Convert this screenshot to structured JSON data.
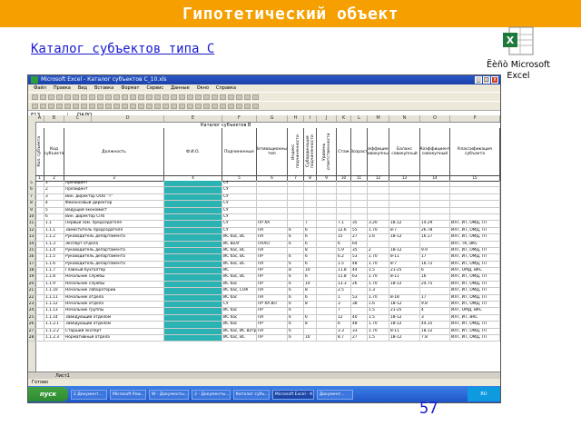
{
  "slide": {
    "title": "Гипотетический объект",
    "subtitle": "Каталог субъектов типа С",
    "page_number": "57",
    "object_label_line1": "Ëèñò Microsoft",
    "object_label_line2": "Excel",
    "colors": {
      "header_bar": "#f5a000",
      "title_text": "#ffffff",
      "subtitle_text": "#1a1ad0"
    }
  },
  "excel": {
    "window_title": "Microsoft Excel - Каталог субъектов С_10.xls",
    "menu": [
      "Файл",
      "Правка",
      "Вид",
      "Вставка",
      "Формат",
      "Сервис",
      "Данные",
      "Окно",
      "Справка"
    ],
    "name_box": "F13",
    "formula": "ПАЛО",
    "columns": [
      "A",
      "B",
      "C",
      "D",
      "E",
      "F",
      "G",
      "H",
      "I",
      "J",
      "K",
      "L",
      "M",
      "N",
      "O",
      "P"
    ],
    "sheet_title": "Каталог субъектов В",
    "table_headers": [
      "Кол. субъекта",
      "Код субъекта",
      "Должность",
      "Ф.И.О.",
      "Подчиненные",
      "Мотивационный тип",
      "Индекс подчиненности",
      "Субординация подчиненности",
      "Уровень ответственности",
      "Стаж",
      "Возраст",
      "Коэффициент совокупный",
      "Баланс совокупный",
      "Коэффициент совокупный",
      "Классификация субъекта"
    ],
    "rows": [
      {
        "n": "5",
        "code": "1",
        "pos": "Президент",
        "sub": "СУ",
        "mt": "",
        "v1": "",
        "v2": "",
        "v3": "",
        "st": "",
        "age": "",
        "k1": "",
        "b": "",
        "k2": "",
        "cls": ""
      },
      {
        "n": "6",
        "code": "2",
        "pos": "Президент",
        "sub": "СУ",
        "mt": "",
        "v1": "",
        "v2": "",
        "v3": "",
        "st": "",
        "age": "",
        "k1": "",
        "b": "",
        "k2": "",
        "cls": ""
      },
      {
        "n": "7",
        "code": "3",
        "pos": "Вин. директор ООО \"Т\"",
        "sub": "СУ",
        "mt": "",
        "v1": "",
        "v2": "",
        "v3": "",
        "st": "",
        "age": "",
        "k1": "",
        "b": "",
        "k2": "",
        "cls": ""
      },
      {
        "n": "8",
        "code": "4",
        "pos": "Финансовый директор",
        "sub": "СУ",
        "mt": "",
        "v1": "",
        "v2": "",
        "v3": "",
        "st": "",
        "age": "",
        "k1": "",
        "b": "",
        "k2": "",
        "cls": ""
      },
      {
        "n": "9",
        "code": "5",
        "pos": "Ведущий экономист",
        "sub": "СУ",
        "mt": "",
        "v1": "",
        "v2": "",
        "v3": "",
        "st": "",
        "age": "",
        "k1": "",
        "b": "",
        "k2": "",
        "cls": ""
      },
      {
        "n": "10",
        "code": "6",
        "pos": "Вин. директор СПб",
        "sub": "СУ",
        "mt": "",
        "v1": "",
        "v2": "",
        "v3": "",
        "st": "",
        "age": "",
        "k1": "",
        "b": "",
        "k2": "",
        "cls": ""
      },
      {
        "n": "11",
        "code": "1.1",
        "pos": "Первый зам. председателя",
        "sub": "СУ",
        "mt": "ПР ХА",
        "v1": "",
        "v2": "7",
        "v3": "",
        "st": "7.1",
        "age": "35",
        "k1": "3.20",
        "b": "18.12",
        "k2": "14.29",
        "cls": "ИЛТ, ИТ, ОМД, ТП"
      },
      {
        "n": "12",
        "code": "1.1.1",
        "pos": "Заместитель председателя",
        "sub": "СУ",
        "mt": "ПА",
        "v1": "6",
        "v2": "6",
        "v3": "",
        "st": "12.6",
        "age": "55",
        "k1": "1.70",
        "b": "8-7",
        "k2": "26.78",
        "cls": "ИЛТ, ИТ, ОМД, ТП"
      },
      {
        "n": "13",
        "code": "1.1.2",
        "pos": "Руководитель департамента",
        "sub": "ИС бас, ВС",
        "mt": "ПА",
        "v1": "6",
        "v2": "6",
        "v3": "",
        "st": "15",
        "age": "27",
        "k1": "1.6",
        "b": "18-12",
        "k2": "16.17",
        "cls": "ИЛТ, ИТ, ОМД, ТП"
      },
      {
        "n": "14",
        "code": "1.1.3",
        "pos": "Эксперт отдела",
        "sub": "ИС Волг",
        "mt": "ПАЛО",
        "v1": "6",
        "v2": "6",
        "v3": "",
        "st": "6",
        "age": "64",
        "k1": "",
        "b": "",
        "k2": "",
        "cls": "ИЛТ, ТК, ВКС"
      },
      {
        "n": "15",
        "code": "1.1.4",
        "pos": "Руководитель департамента",
        "sub": "ИС бас, ВС",
        "mt": "ПА",
        "v1": "",
        "v2": "8",
        "v3": "",
        "st": "5.9",
        "age": "35",
        "k1": "2",
        "b": "18-12",
        "k2": "9.9",
        "cls": "ИЛТ, ИТ, ОМД, ТП"
      },
      {
        "n": "16",
        "code": "1.1.5",
        "pos": "Руководитель департамента",
        "sub": "ИС бас, ВС",
        "mt": "ПР",
        "v1": "6",
        "v2": "6",
        "v3": "",
        "st": "6.2",
        "age": "53",
        "k1": "1.70",
        "b": "8-11",
        "k2": "17",
        "cls": "ИЛТ, ИТ, ОМД, ТП"
      },
      {
        "n": "17",
        "code": "1.1.6",
        "pos": "Руководитель департамента",
        "sub": "ИС бас, ВС",
        "mt": "ПА",
        "v1": "6",
        "v2": "6",
        "v3": "",
        "st": "1.5",
        "age": "48",
        "k1": "1.70",
        "b": "8-7",
        "k2": "16.72",
        "cls": "ИЛТ, ИТ, ОМД, ТП"
      },
      {
        "n": "18",
        "code": "1.1.7",
        "pos": "Главный бухгалтер",
        "sub": "ИС",
        "mt": "ПР",
        "v1": "8",
        "v2": "10",
        "v3": "",
        "st": "11.8",
        "age": "44",
        "k1": "1.5",
        "b": "21-25",
        "k2": "6",
        "cls": "ИЛТ, ОМД, ВКС"
      },
      {
        "n": "19",
        "code": "1.1.8",
        "pos": "Начальник службы",
        "sub": "ИС бас, ВС",
        "mt": "ПР",
        "v1": "6",
        "v2": "6",
        "v3": "",
        "st": "11.8",
        "age": "63",
        "k1": "1.70",
        "b": "8-11",
        "k2": "16",
        "cls": "ИЛТ, ИТ, ОМД, ТП"
      },
      {
        "n": "20",
        "code": "1.1.9",
        "pos": "Начальник службы",
        "sub": "ИС бас",
        "mt": "ПР",
        "v1": "6",
        "v2": "10",
        "v3": "",
        "st": "13.3",
        "age": "26",
        "k1": "1.70",
        "b": "18-12",
        "k2": "24.75",
        "cls": "ИЛТ, ИТ, ОМД, ТП"
      },
      {
        "n": "21",
        "code": "1.1.10",
        "pos": "Начальник лаборатории",
        "sub": "ИС бас, СОК",
        "mt": "ПА",
        "v1": "6",
        "v2": "8",
        "v3": "",
        "st": "2.5",
        "age": "",
        "k1": "1.3",
        "b": "",
        "k2": "",
        "cls": "ИЛТ, ИТ, ОМД, ТП"
      },
      {
        "n": "22",
        "code": "1.1.11",
        "pos": "Начальник отдела",
        "sub": "ИС бас",
        "mt": "ПА",
        "v1": "6",
        "v2": "6",
        "v3": "",
        "st": "1",
        "age": "53",
        "k1": "1.70",
        "b": "8-18",
        "k2": "17",
        "cls": "ИЛТ, ИТ, ОМД, ТП"
      },
      {
        "n": "23",
        "code": "1.1.12",
        "pos": "Начальник отдела",
        "sub": "СУ",
        "mt": "ПР ХА ВО",
        "v1": "6",
        "v2": "8",
        "v3": "",
        "st": "3",
        "age": "38",
        "k1": "1.6",
        "b": "18-12",
        "k2": "9.8",
        "cls": "ИЛТ, ИТ, ОМД, ТП"
      },
      {
        "n": "24",
        "code": "1.1.13",
        "pos": "Начальник группы",
        "sub": "ИС бас",
        "mt": "ПР",
        "v1": "6",
        "v2": "",
        "v3": "",
        "st": "7",
        "age": "",
        "k1": "1.5",
        "b": "21-25",
        "k2": "4",
        "cls": "ИЛТ, ОМД, ВКС"
      },
      {
        "n": "25",
        "code": "1.1.14",
        "pos": "Заведующий отделом",
        "sub": "ИС бас",
        "mt": "ПА",
        "v1": "6",
        "v2": "6",
        "v3": "",
        "st": "12",
        "age": "40",
        "k1": "1.5",
        "b": "18-12",
        "k2": "3",
        "cls": "ИЛТ, ИТ, ВКС"
      },
      {
        "n": "26",
        "code": "1.1.2.1",
        "pos": "Заведующий отделом",
        "sub": "ИС бас",
        "mt": "ПР",
        "v1": "6",
        "v2": "8",
        "v3": "",
        "st": "6",
        "age": "48",
        "k1": "1.70",
        "b": "18-12",
        "k2": "44.35",
        "cls": "ИЛТ, ИТ, ОМД, ТП"
      },
      {
        "n": "27",
        "code": "1.1.2.2",
        "pos": "Старший эксперт",
        "sub": "ИС бас, ИС Вотр",
        "mt": "ПА",
        "v1": "6",
        "v2": "",
        "v3": "",
        "st": "3.3",
        "age": "33",
        "k1": "1.70",
        "b": "8-11",
        "k2": "18.12",
        "cls": "ИЛТ, ИТ, ОМД, ТП"
      },
      {
        "n": "28",
        "code": "1.1.2.3",
        "pos": "Нормативный отдела",
        "sub": "ИС бас, ВС",
        "mt": "ПР",
        "v1": "6",
        "v2": "10",
        "v3": "",
        "st": "8.7",
        "age": "27",
        "k1": "1.5",
        "b": "18-12",
        "k2": "7.8",
        "cls": "ИЛТ, ИТ, ОМД, ТП"
      }
    ],
    "sheet_tab": "Лист1",
    "status_text": "Готово"
  },
  "taskbar": {
    "start_label": "пуск",
    "items": [
      "2 Документ...",
      "Microsoft Pow...",
      "W - Документы...",
      "2 - Документы...",
      "Каталог субъ...",
      "Microsoft Excel - К...",
      "Документ..."
    ],
    "clock": "RU"
  }
}
